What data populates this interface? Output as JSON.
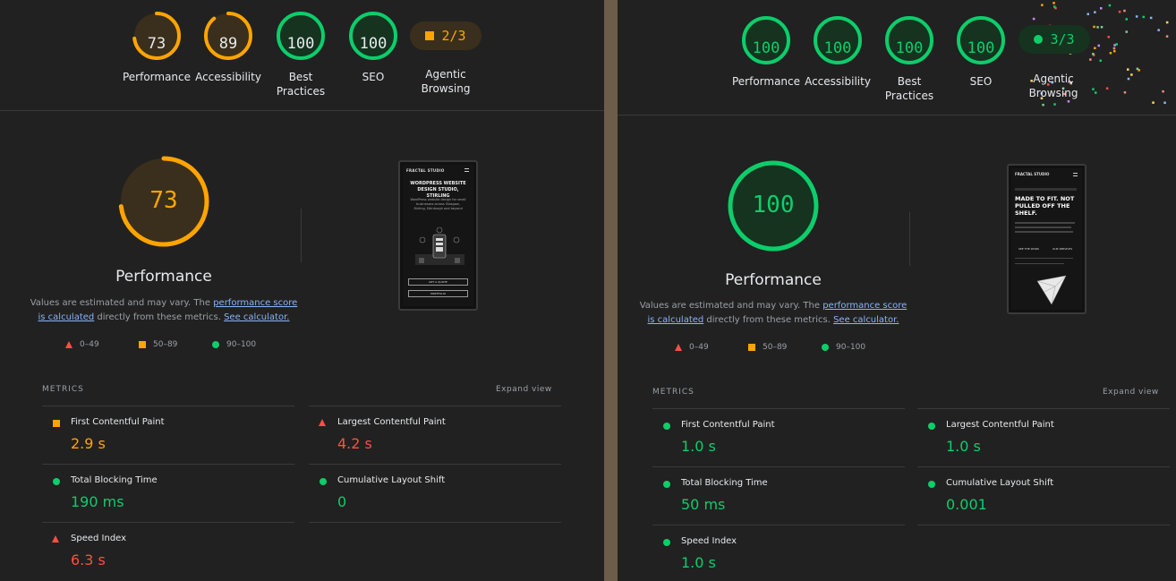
{
  "colors": {
    "pass": "#0cce6b",
    "average": "#ffa400",
    "fail": "#ff4e42",
    "background": "#212121",
    "link": "#8ab4f8"
  },
  "panels": [
    {
      "scores": [
        {
          "value": "73",
          "label": "Performance",
          "rating": "average",
          "fraction": 0.73
        },
        {
          "value": "89",
          "label": "Accessibility",
          "rating": "average",
          "fraction": 0.89
        },
        {
          "value": "100",
          "label": "Best Practices",
          "rating": "pass",
          "fraction": 1.0
        },
        {
          "value": "100",
          "label": "SEO",
          "rating": "pass",
          "fraction": 1.0
        }
      ],
      "agentic": {
        "value": "2/3",
        "label": "Agentic Browsing",
        "rating": "average"
      },
      "performance": {
        "score": "73",
        "fraction": 0.73,
        "rating": "average",
        "title": "Performance",
        "desc_prefix": "Values are estimated and may vary. The ",
        "link1": "performance score is calculated",
        "desc_mid": " directly from these metrics. ",
        "link2": "See calculator."
      },
      "legend": [
        "0–49",
        "50–89",
        "90–100"
      ],
      "screenshot": {
        "brand": "FRACTAL STUDIO",
        "headline": "WORDPRESS WEBSITE DESIGN STUDIO, STIRLING",
        "body": "WordPress website design for small businesses across Glasgow, Stirling, Edinburgh and beyond",
        "button1": "GET A QUOTE",
        "button2": "PORTFOLIO"
      },
      "metrics_title": "METRICS",
      "expand": "Expand view",
      "metrics": [
        {
          "name": "First Contentful Paint",
          "value": "2.9 s",
          "rating": "average"
        },
        {
          "name": "Largest Contentful Paint",
          "value": "4.2 s",
          "rating": "fail"
        },
        {
          "name": "Total Blocking Time",
          "value": "190 ms",
          "rating": "pass"
        },
        {
          "name": "Cumulative Layout Shift",
          "value": "0",
          "rating": "pass"
        },
        {
          "name": "Speed Index",
          "value": "6.3 s",
          "rating": "fail"
        }
      ]
    },
    {
      "scores": [
        {
          "value": "100",
          "label": "Performance",
          "rating": "pass",
          "fraction": 1.0
        },
        {
          "value": "100",
          "label": "Accessibility",
          "rating": "pass",
          "fraction": 1.0
        },
        {
          "value": "100",
          "label": "Best Practices",
          "rating": "pass",
          "fraction": 1.0
        },
        {
          "value": "100",
          "label": "SEO",
          "rating": "pass",
          "fraction": 1.0
        }
      ],
      "agentic": {
        "value": "3/3",
        "label": "Agentic Browsing",
        "rating": "pass"
      },
      "performance": {
        "score": "100",
        "fraction": 1.0,
        "rating": "pass",
        "title": "Performance",
        "desc_prefix": "Values are estimated and may vary. The ",
        "link1": "performance score is calculated",
        "desc_mid": " directly from these metrics. ",
        "link2": "See calculator."
      },
      "legend": [
        "0–49",
        "50–89",
        "90–100"
      ],
      "screenshot": {
        "brand": "FRACTAL STUDIO",
        "headline": "MADE TO FIT. NOT PULLED OFF THE SHELF.",
        "button1": "SEE THE WORK",
        "button2": "OUR SERVICES"
      },
      "metrics_title": "METRICS",
      "expand": "Expand view",
      "metrics": [
        {
          "name": "First Contentful Paint",
          "value": "1.0 s",
          "rating": "pass"
        },
        {
          "name": "Largest Contentful Paint",
          "value": "1.0 s",
          "rating": "pass"
        },
        {
          "name": "Total Blocking Time",
          "value": "50 ms",
          "rating": "pass"
        },
        {
          "name": "Cumulative Layout Shift",
          "value": "0.001",
          "rating": "pass"
        },
        {
          "name": "Speed Index",
          "value": "1.0 s",
          "rating": "pass"
        }
      ]
    }
  ]
}
